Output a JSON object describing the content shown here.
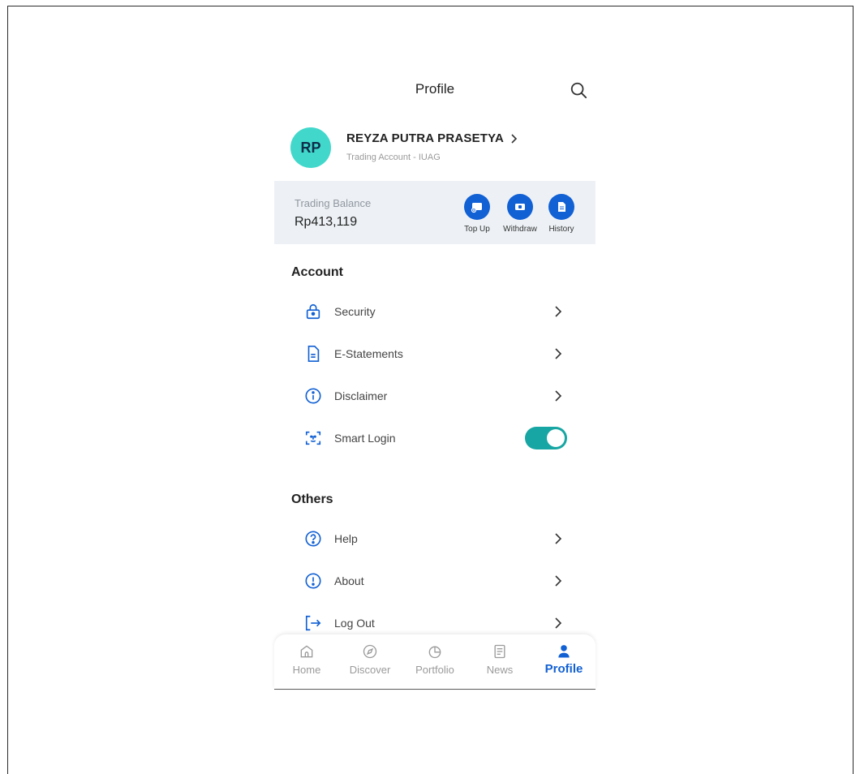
{
  "header": {
    "title": "Profile"
  },
  "user": {
    "initials": "RP",
    "name": "REYZA PUTRA PRASETYA",
    "account_line": "Trading Account - IUAG"
  },
  "balance": {
    "label": "Trading Balance",
    "value": "Rp413,119",
    "actions": [
      {
        "label": "Top Up",
        "icon": "top-up-icon"
      },
      {
        "label": "Withdraw",
        "icon": "withdraw-icon"
      },
      {
        "label": "History",
        "icon": "history-icon"
      }
    ]
  },
  "account": {
    "title": "Account",
    "items": [
      {
        "label": "Security",
        "icon": "lock-icon"
      },
      {
        "label": "E-Statements",
        "icon": "document-icon"
      },
      {
        "label": "Disclaimer",
        "icon": "info-icon"
      },
      {
        "label": "Smart Login",
        "icon": "face-id-icon",
        "toggle_on": true
      }
    ]
  },
  "others": {
    "title": "Others",
    "items": [
      {
        "label": "Help",
        "icon": "help-icon"
      },
      {
        "label": "About",
        "icon": "alert-icon"
      },
      {
        "label": "Log Out",
        "icon": "logout-icon"
      }
    ]
  },
  "nav": {
    "items": [
      {
        "label": "Home",
        "icon": "home-icon"
      },
      {
        "label": "Discover",
        "icon": "compass-icon"
      },
      {
        "label": "Portfolio",
        "icon": "pie-chart-icon"
      },
      {
        "label": "News",
        "icon": "news-icon"
      },
      {
        "label": "Profile",
        "icon": "person-icon",
        "active": true
      }
    ]
  },
  "colors": {
    "primary": "#1160d4",
    "avatar_bg": "#41d8cb",
    "toggle_on": "#17a6a3",
    "card_bg": "#edf1f5"
  }
}
